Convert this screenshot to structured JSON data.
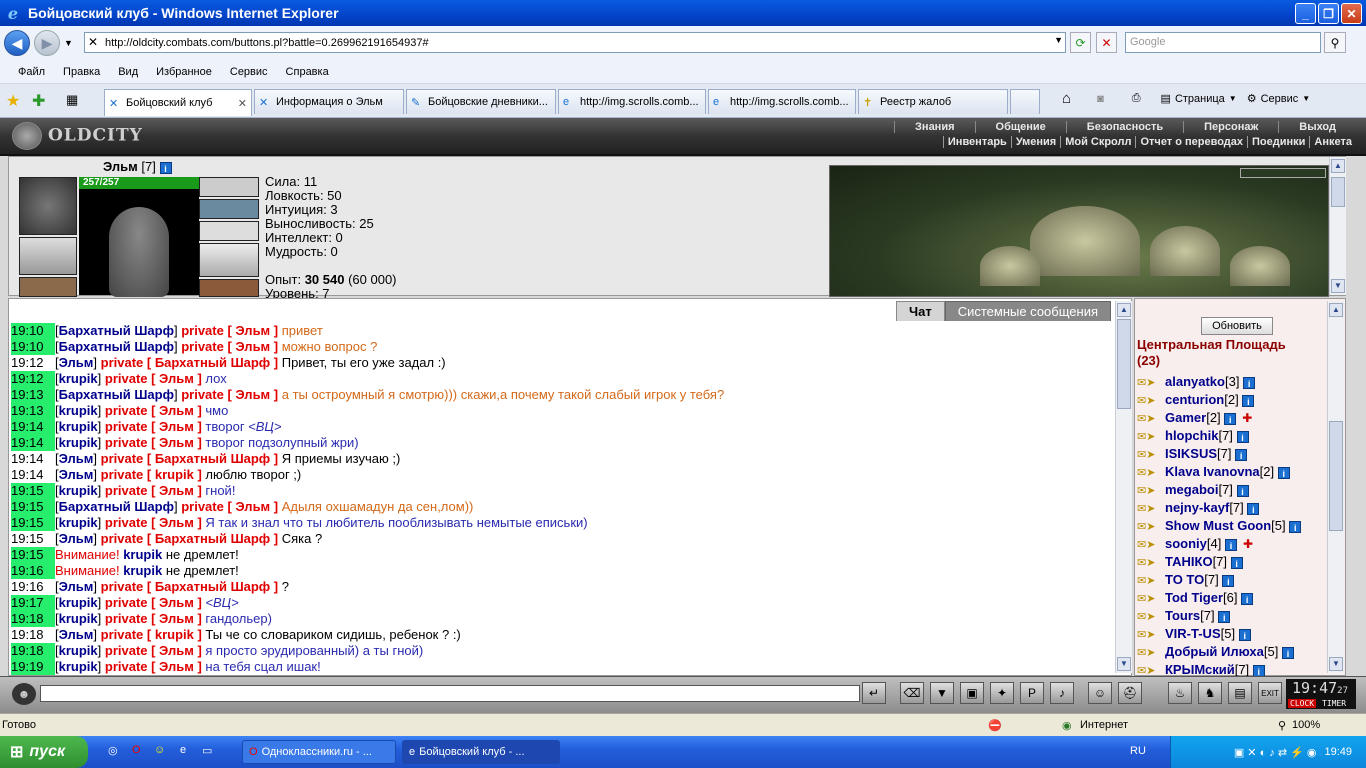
{
  "window": {
    "title": "Бойцовский клуб - Windows Internet Explorer"
  },
  "address": {
    "url": "http://oldcity.combats.com/buttons.pl?battle=0.269962191654937#",
    "search_placeholder": "Google"
  },
  "menu": [
    "Файл",
    "Правка",
    "Вид",
    "Избранное",
    "Сервис",
    "Справка"
  ],
  "tabs": [
    {
      "label": "Бойцовский клуб"
    },
    {
      "label": "Информация о Эльм"
    },
    {
      "label": "Бойцовские дневники..."
    },
    {
      "label": "http://img.scrolls.comb..."
    },
    {
      "label": "http://img.scrolls.comb..."
    },
    {
      "label": "Реестр жалоб"
    }
  ],
  "tab_tools": {
    "page": "Страница",
    "service": "Сервис"
  },
  "game": {
    "logo": "OLDCITY",
    "topnav": [
      "Знания",
      "Общение",
      "Безопасность",
      "Персонаж",
      "Выход"
    ],
    "subnav": [
      "Инвентарь",
      "Умения",
      "Мой Скролл",
      "Отчет о переводах",
      "Поединки",
      "Анкета"
    ],
    "character": {
      "name": "Эльм",
      "level": "[7]",
      "hp": "257/257",
      "stats": [
        "Сила: 11",
        "Ловкость: 50",
        "Интуиция: 3",
        "Выносливость: 25",
        "Интеллект: 0",
        "Мудрость: 0"
      ],
      "exp_label": "Опыт:",
      "exp_value": "30 540",
      "exp_next": "(60 000)",
      "level_label": "Уровень: 7"
    },
    "chat_tabs": {
      "chat": "Чат",
      "system": "Системные сообщения"
    },
    "chat": [
      {
        "t": "19:10",
        "hl": true,
        "parts": [
          [
            "k",
            "["
          ],
          [
            "n",
            "Бархатный Шарф"
          ],
          [
            "k",
            "] "
          ],
          [
            "p",
            "private [ Эльм ]"
          ],
          [
            "o",
            " привет"
          ]
        ]
      },
      {
        "t": "19:10",
        "hl": true,
        "parts": [
          [
            "k",
            "["
          ],
          [
            "n",
            "Бархатный Шарф"
          ],
          [
            "k",
            "] "
          ],
          [
            "p",
            "private [ Эльм ]"
          ],
          [
            "o",
            " можно вопрос ?"
          ]
        ]
      },
      {
        "t": "19:12",
        "hl": false,
        "parts": [
          [
            "k",
            "["
          ],
          [
            "n",
            "Эльм"
          ],
          [
            "k",
            "] "
          ],
          [
            "p",
            "private [ Бархатный Шарф ]"
          ],
          [
            "k",
            " Привет, ты его уже задал :)"
          ]
        ]
      },
      {
        "t": "19:12",
        "hl": true,
        "parts": [
          [
            "k",
            "["
          ],
          [
            "n",
            "krupik"
          ],
          [
            "k",
            "] "
          ],
          [
            "p",
            "private [ Эльм ]"
          ],
          [
            "b",
            " лох"
          ]
        ]
      },
      {
        "t": "19:13",
        "hl": true,
        "parts": [
          [
            "k",
            "["
          ],
          [
            "n",
            "Бархатный Шарф"
          ],
          [
            "k",
            "] "
          ],
          [
            "p",
            "private [ Эльм ]"
          ],
          [
            "o",
            " а ты остроумный я смотрю))) скажи,а почему такой слабый игрок у тебя?"
          ]
        ]
      },
      {
        "t": "19:13",
        "hl": true,
        "parts": [
          [
            "k",
            "["
          ],
          [
            "n",
            "krupik"
          ],
          [
            "k",
            "] "
          ],
          [
            "p",
            "private [ Эльм ]"
          ],
          [
            "b",
            " чмо"
          ]
        ]
      },
      {
        "t": "19:14",
        "hl": true,
        "parts": [
          [
            "k",
            "["
          ],
          [
            "n",
            "krupik"
          ],
          [
            "k",
            "] "
          ],
          [
            "p",
            "private [ Эльм ]"
          ],
          [
            "b",
            " творог "
          ],
          [
            "bi",
            "<ВЦ>"
          ]
        ]
      },
      {
        "t": "19:14",
        "hl": true,
        "parts": [
          [
            "k",
            "["
          ],
          [
            "n",
            "krupik"
          ],
          [
            "k",
            "] "
          ],
          [
            "p",
            "private [ Эльм ]"
          ],
          [
            "b",
            " творог подзолупный жри)"
          ]
        ]
      },
      {
        "t": "19:14",
        "hl": false,
        "parts": [
          [
            "k",
            "["
          ],
          [
            "n",
            "Эльм"
          ],
          [
            "k",
            "] "
          ],
          [
            "p",
            "private [ Бархатный Шарф ]"
          ],
          [
            "k",
            " Я приемы изучаю ;)"
          ]
        ]
      },
      {
        "t": "19:14",
        "hl": false,
        "parts": [
          [
            "k",
            "["
          ],
          [
            "n",
            "Эльм"
          ],
          [
            "k",
            "] "
          ],
          [
            "p",
            "private [ krupik ]"
          ],
          [
            "k",
            " люблю творог ;)"
          ]
        ]
      },
      {
        "t": "19:15",
        "hl": true,
        "parts": [
          [
            "k",
            "["
          ],
          [
            "n",
            "krupik"
          ],
          [
            "k",
            "] "
          ],
          [
            "p",
            "private [ Эльм ]"
          ],
          [
            "b",
            " гной!"
          ]
        ]
      },
      {
        "t": "19:15",
        "hl": true,
        "parts": [
          [
            "k",
            "["
          ],
          [
            "n",
            "Бархатный Шарф"
          ],
          [
            "k",
            "] "
          ],
          [
            "p",
            "private [ Эльм ]"
          ],
          [
            "o",
            " Адыля охшамадун да сен,лом))"
          ]
        ]
      },
      {
        "t": "19:15",
        "hl": true,
        "parts": [
          [
            "k",
            "["
          ],
          [
            "n",
            "krupik"
          ],
          [
            "k",
            "] "
          ],
          [
            "p",
            "private [ Эльм ]"
          ],
          [
            "b",
            " Я так и знал что ты любитель пооблизывать немытые еписьки)"
          ]
        ]
      },
      {
        "t": "19:15",
        "hl": false,
        "parts": [
          [
            "k",
            "["
          ],
          [
            "n",
            "Эльм"
          ],
          [
            "k",
            "] "
          ],
          [
            "p",
            "private [ Бархатный Шарф ]"
          ],
          [
            "k",
            " Сяка ?"
          ]
        ]
      },
      {
        "t": "19:15",
        "hl": true,
        "parts": [
          [
            "w",
            "Внимание! "
          ],
          [
            "n",
            "krupik"
          ],
          [
            "k",
            " не дремлет!"
          ]
        ]
      },
      {
        "t": "19:16",
        "hl": true,
        "parts": [
          [
            "w",
            "Внимание! "
          ],
          [
            "n",
            "krupik"
          ],
          [
            "k",
            " не дремлет!"
          ]
        ]
      },
      {
        "t": "19:16",
        "hl": false,
        "parts": [
          [
            "k",
            "["
          ],
          [
            "n",
            "Эльм"
          ],
          [
            "k",
            "] "
          ],
          [
            "p",
            "private [ Бархатный Шарф ]"
          ],
          [
            "k",
            " ?"
          ]
        ]
      },
      {
        "t": "19:17",
        "hl": true,
        "parts": [
          [
            "k",
            "["
          ],
          [
            "n",
            "krupik"
          ],
          [
            "k",
            "] "
          ],
          [
            "p",
            "private [ Эльм ]"
          ],
          [
            "bi",
            " <ВЦ>"
          ]
        ]
      },
      {
        "t": "19:18",
        "hl": true,
        "parts": [
          [
            "k",
            "["
          ],
          [
            "n",
            "krupik"
          ],
          [
            "k",
            "] "
          ],
          [
            "p",
            "private [ Эльм ]"
          ],
          [
            "b",
            " гандольер)"
          ]
        ]
      },
      {
        "t": "19:18",
        "hl": false,
        "parts": [
          [
            "k",
            "["
          ],
          [
            "n",
            "Эльм"
          ],
          [
            "k",
            "] "
          ],
          [
            "p",
            "private [ krupik ]"
          ],
          [
            "k",
            " Ты че со словариком сидишь, ребенок ? :)"
          ]
        ]
      },
      {
        "t": "19:18",
        "hl": true,
        "parts": [
          [
            "k",
            "["
          ],
          [
            "n",
            "krupik"
          ],
          [
            "k",
            "] "
          ],
          [
            "p",
            "private [ Эльм ]"
          ],
          [
            "b",
            " я просто эрудированный) а ты гной)"
          ]
        ]
      },
      {
        "t": "19:19",
        "hl": true,
        "parts": [
          [
            "k",
            "["
          ],
          [
            "n",
            "krupik"
          ],
          [
            "k",
            "] "
          ],
          [
            "p",
            "private [ Эльм ]"
          ],
          [
            "b",
            " на тебя сцал ишак!"
          ]
        ]
      }
    ],
    "refresh_btn": "Обновить",
    "location": "Центральная Площадь",
    "location_count": "(23)",
    "players": [
      {
        "name": "alanyatko",
        "lvl": "[3]"
      },
      {
        "name": "centurion",
        "lvl": "[2]"
      },
      {
        "name": "Gamer",
        "lvl": "[2]",
        "badge": true
      },
      {
        "name": "hlopchik",
        "lvl": "[7]"
      },
      {
        "name": "ISIKSUS",
        "lvl": "[7]"
      },
      {
        "name": "Klava Ivanovna",
        "lvl": "[2]"
      },
      {
        "name": "megaboi",
        "lvl": "[7]"
      },
      {
        "name": "nejny-kayf",
        "lvl": "[7]"
      },
      {
        "name": "Show Must Goon",
        "lvl": "[5]"
      },
      {
        "name": "sooniy",
        "lvl": "[4]",
        "badge": true
      },
      {
        "name": "ТАНІКО",
        "lvl": "[7]"
      },
      {
        "name": "TO TO",
        "lvl": "[7]"
      },
      {
        "name": "Tod Tiger",
        "lvl": "[6]"
      },
      {
        "name": "Tours",
        "lvl": "[7]"
      },
      {
        "name": "VIR-T-US",
        "lvl": "[5]"
      },
      {
        "name": "Добрый Илюха",
        "lvl": "[5]"
      },
      {
        "name": "КРЫМский",
        "lvl": "[7]"
      }
    ],
    "clock": {
      "time": "19:47",
      "sec": "27",
      "label1": "CLOCK",
      "label2": "TIMER"
    }
  },
  "status": {
    "left": "Готово",
    "zone": "Интернет",
    "zoom": "100%"
  },
  "taskbar": {
    "start": "пуск",
    "tasks": [
      "Одноклассники.ru - ...",
      "Бойцовский клуб - ..."
    ],
    "lang": "RU",
    "time": "19:49"
  }
}
